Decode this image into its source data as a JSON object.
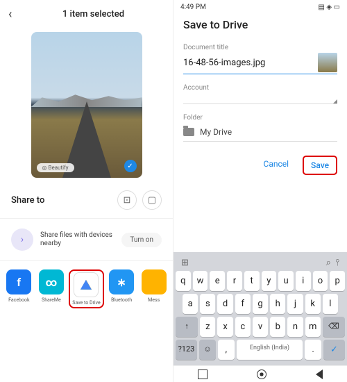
{
  "left": {
    "title": "1 item selected",
    "beautify_label": "Beautify",
    "share_label": "Share to",
    "nearby_text": "Share files with devices nearby",
    "turnon_label": "Turn on",
    "apps": [
      {
        "name": "Facebook"
      },
      {
        "name": "ShareMe"
      },
      {
        "name": "Save to Drive"
      },
      {
        "name": "Bluetooth"
      },
      {
        "name": "Mess"
      }
    ]
  },
  "right": {
    "time": "4:49 PM",
    "title": "Save to Drive",
    "doc_label": "Document title",
    "doc_value": "16-48-56-images.jpg",
    "account_label": "Account",
    "folder_label": "Folder",
    "folder_value": "My Drive",
    "cancel": "Cancel",
    "save": "Save",
    "keyboard": {
      "row1": [
        "q",
        "w",
        "e",
        "r",
        "t",
        "y",
        "u",
        "i",
        "o",
        "p"
      ],
      "row2": [
        "a",
        "s",
        "d",
        "f",
        "g",
        "h",
        "j",
        "k",
        "l"
      ],
      "row3": [
        "z",
        "x",
        "c",
        "v",
        "b",
        "n",
        "m"
      ],
      "shift": "↑",
      "bksp": "⌫",
      "num": "?123",
      "emoji": "☺",
      "comma": ",",
      "space": "English (India)",
      "period": ".",
      "enter": "✓"
    }
  }
}
